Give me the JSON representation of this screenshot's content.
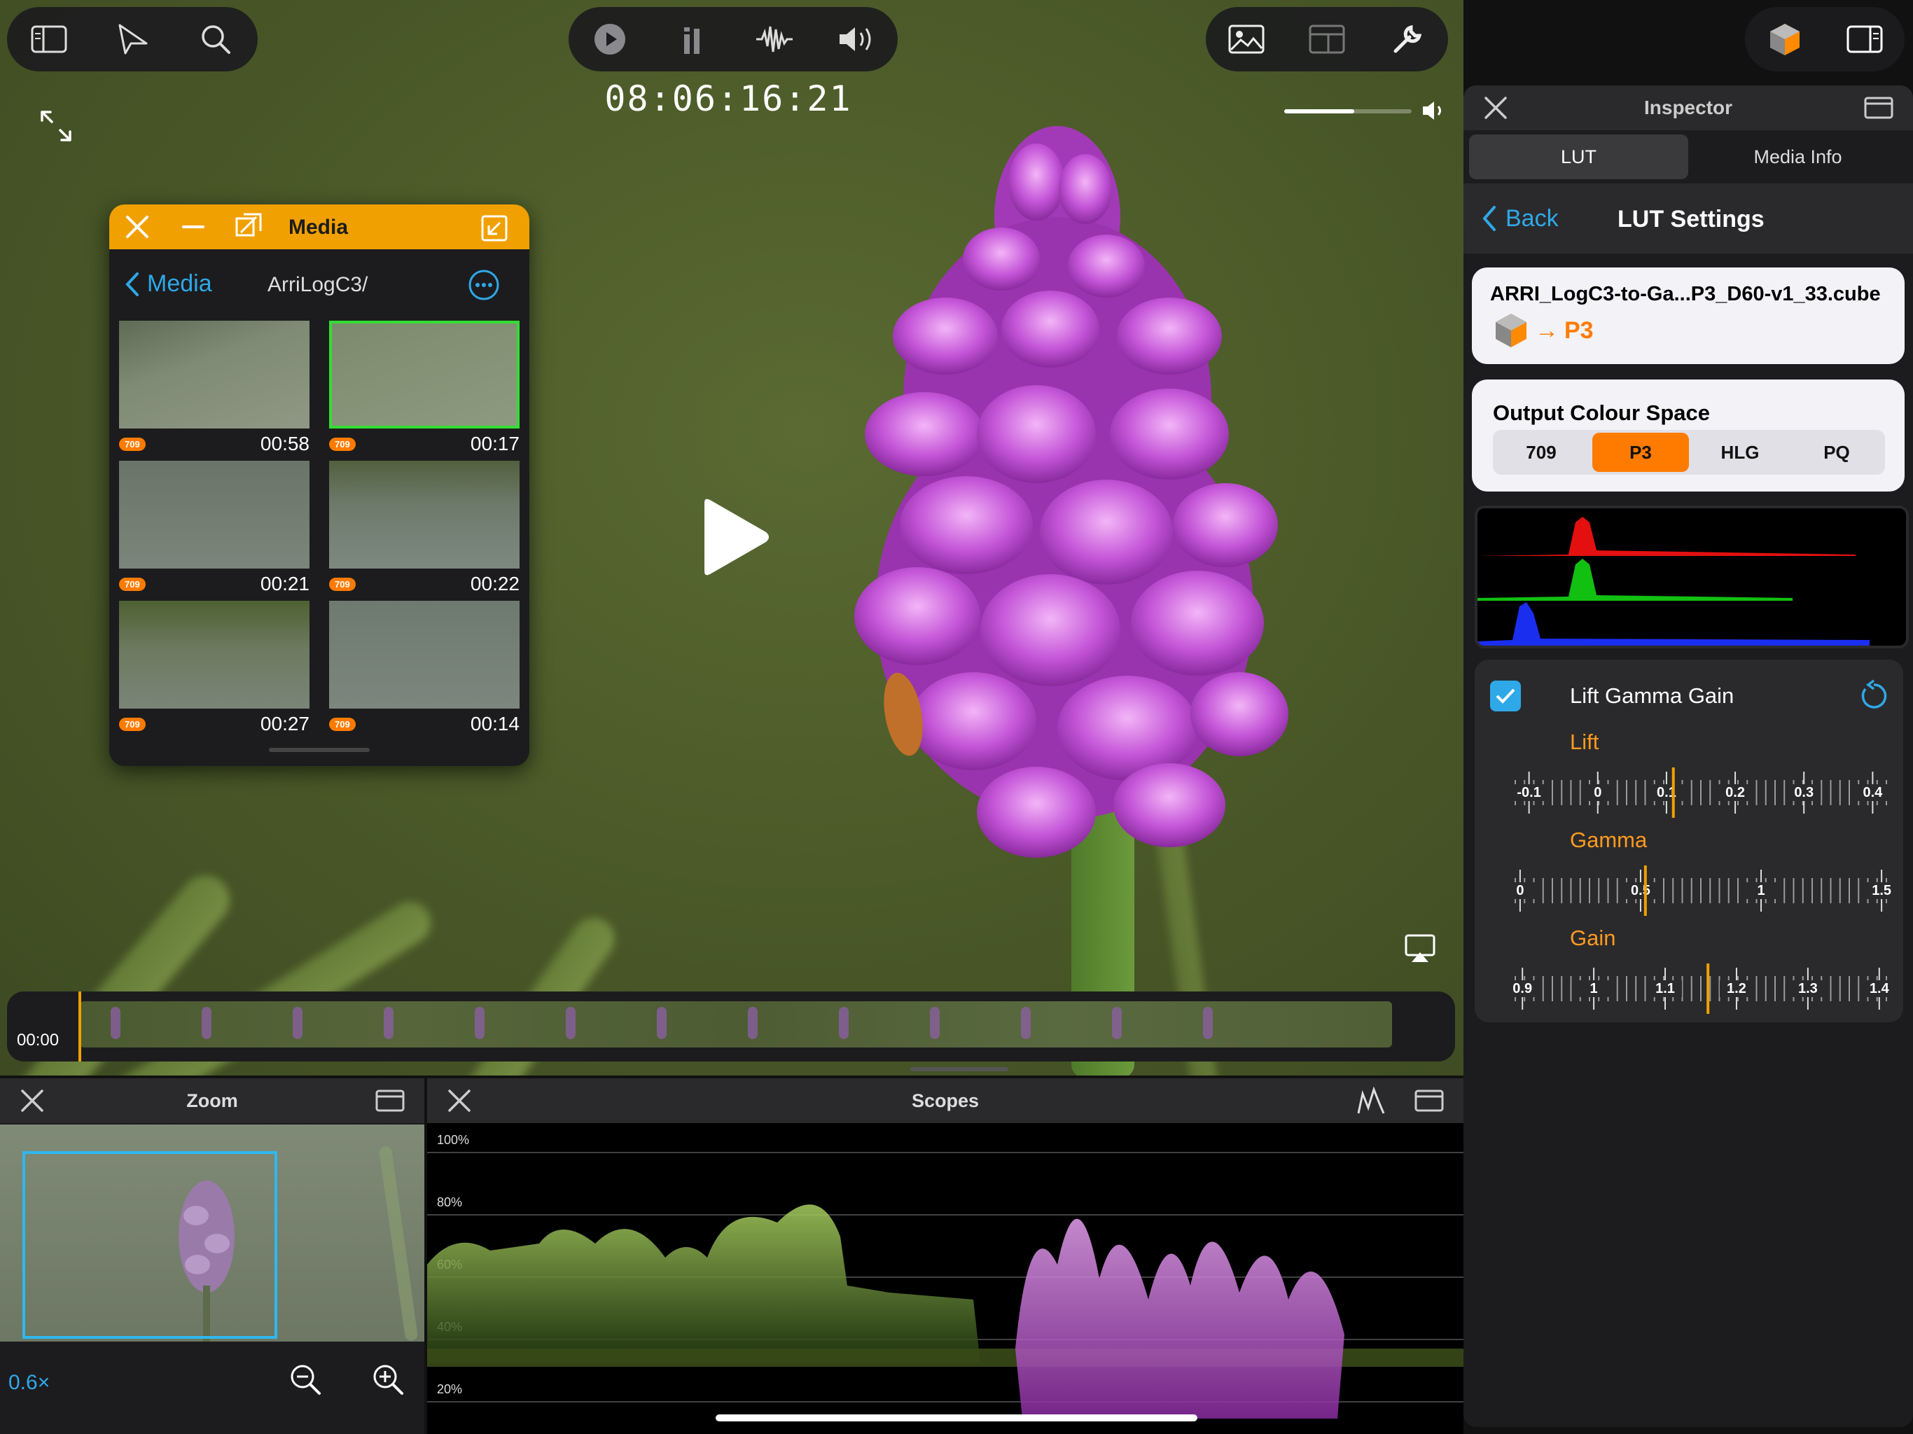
{
  "viewer": {
    "timecode": "08:06:16:21",
    "volume_level": 0.55
  },
  "toolbar_left": {
    "icons": [
      "sidebar-icon",
      "send-icon",
      "search-icon"
    ]
  },
  "toolbar_center": {
    "icons": [
      "play-circle-icon",
      "meters-icon",
      "waveform-icon",
      "speaker-icon"
    ]
  },
  "toolbar_right": {
    "icons": [
      "photo-icon",
      "layout-icon",
      "wrench-icon"
    ]
  },
  "top_right": {
    "icons": [
      "lut-cube-icon",
      "sidebar-right-icon"
    ]
  },
  "media_window": {
    "title": "Media",
    "back_label": "Media",
    "folder": "ArriLogC3/",
    "clips": [
      {
        "badge": "709",
        "duration": "00:58",
        "selected": false
      },
      {
        "badge": "709",
        "duration": "00:17",
        "selected": true
      },
      {
        "badge": "709",
        "duration": "00:21",
        "selected": false
      },
      {
        "badge": "709",
        "duration": "00:22",
        "selected": false
      },
      {
        "badge": "709",
        "duration": "00:27",
        "selected": false
      },
      {
        "badge": "709",
        "duration": "00:14",
        "selected": false
      }
    ]
  },
  "timeline": {
    "position": "00:00"
  },
  "zoom_panel": {
    "title": "Zoom",
    "zoom_level": "0.6×"
  },
  "scopes_panel": {
    "title": "Scopes",
    "levels": [
      "100%",
      "80%",
      "60%",
      "40%",
      "20%"
    ]
  },
  "inspector": {
    "title": "Inspector",
    "tabs": [
      "LUT",
      "Media Info"
    ],
    "active_tab": "LUT",
    "back_label": "Back",
    "section_title": "LUT Settings",
    "lut_file": "ARRI_LogC3-to-Ga...P3_D60-v1_33.cube",
    "lut_target": "P3",
    "output_colour_space": {
      "label": "Output Colour Space",
      "options": [
        "709",
        "P3",
        "HLG",
        "PQ"
      ],
      "selected": "P3"
    },
    "lgg": {
      "label": "Lift Gamma Gain",
      "enabled": true,
      "lift": {
        "label": "Lift",
        "ticks": [
          "-0.1",
          "0",
          "0.1",
          "0.2",
          "0.3",
          "0.4"
        ],
        "value": 0.11
      },
      "gamma": {
        "label": "Gamma",
        "ticks": [
          "0",
          "0.5",
          "1",
          "1.5"
        ],
        "value": 0.52
      },
      "gain": {
        "label": "Gain",
        "ticks": [
          "0.9",
          "1",
          "1.1",
          "1.2",
          "1.3",
          "1.4"
        ],
        "value": 1.16
      }
    }
  },
  "colors": {
    "accent_orange": "#f0a000",
    "accent_blue": "#2fa8e8",
    "selected_segment": "#ff7b00",
    "selection_green": "#33dd33"
  }
}
